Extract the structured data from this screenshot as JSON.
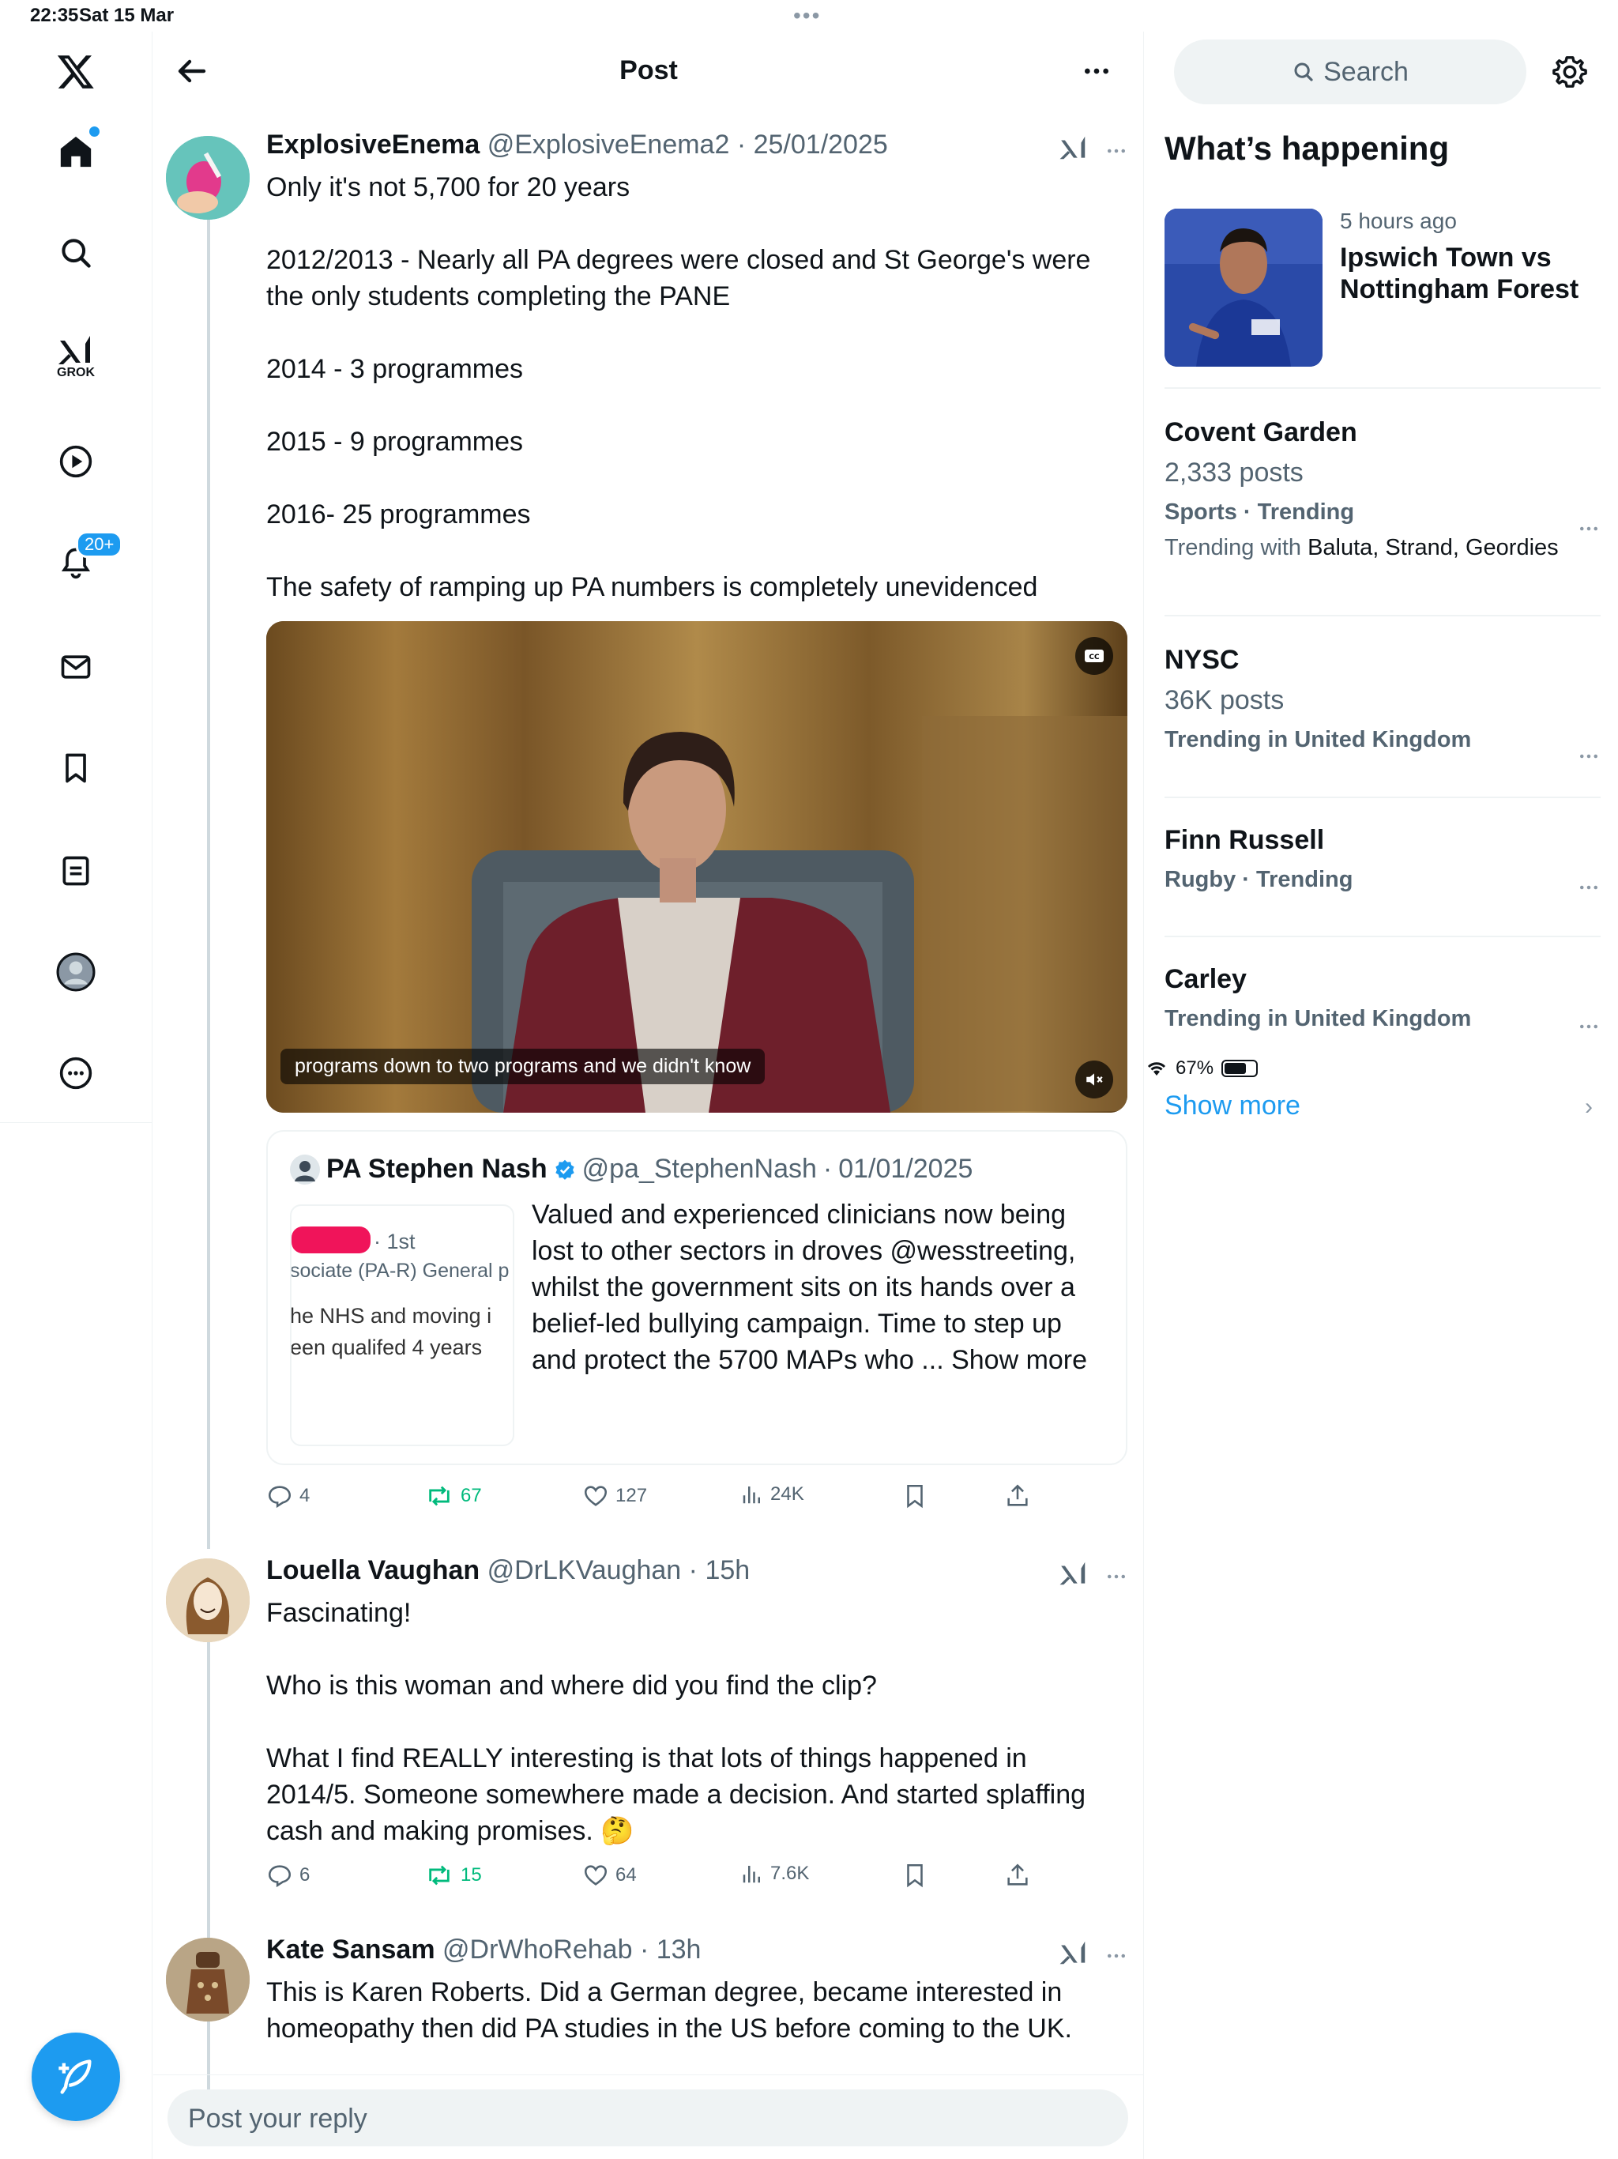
{
  "status_bar": {
    "time": "22:35",
    "date": "Sat 15 Mar",
    "battery": "67%",
    "battery_level": 0.67
  },
  "nav": {
    "grok_label": "GROK",
    "notifications_badge": "20+"
  },
  "header": {
    "title": "Post"
  },
  "main_post": {
    "name": "ExplosiveEnema",
    "handle": "@ExplosiveEnema2",
    "date": "25/01/2025",
    "lines": [
      "Only it's not 5,700 for 20 years",
      "2012/2013 - Nearly all PA degrees were closed and St George's were the only students completing the PANE",
      "2014 - 3 programmes",
      "2015 - 9 programmes",
      "2016- 25 programmes",
      "The safety of ramping up PA numbers is completely unevidenced"
    ],
    "video_caption": "programs down to two programs and we didn't know",
    "quote": {
      "name": "PA Stephen Nash",
      "handle": "@pa_StephenNash",
      "date": "01/01/2025",
      "image_text": [
        "· 1st",
        "sociate (PA-R) General p",
        "he NHS and moving i",
        "een qualifed 4 years"
      ],
      "text": "Valued and experienced clinicians now being lost to other sectors in droves @wesstreeting, whilst the government sits on its hands over a belief-led bullying campaign. Time to step up and protect the 5700 MAPs who ... Show more"
    },
    "stats": {
      "replies": "4",
      "reposts": "67",
      "likes": "127",
      "views": "24K"
    }
  },
  "replies": [
    {
      "name": "Louella Vaughan",
      "handle": "@DrLKVaughan",
      "time": "15h",
      "lines": [
        "Fascinating!",
        "Who is this woman and where did you find the clip?",
        "What I find REALLY interesting is that lots of things happened in 2014/5. Someone somewhere made a decision. And started splaffing cash and making promises. 🤔"
      ],
      "stats": {
        "replies": "6",
        "reposts": "15",
        "likes": "64",
        "views": "7.6K"
      }
    },
    {
      "name": "Kate Sansam",
      "handle": "@DrWhoRehab",
      "time": "13h",
      "lines": [
        "This is Karen Roberts. Did a German degree, became interested in homeopathy then did PA studies in the US before coming to the UK."
      ]
    }
  ],
  "reply_placeholder": "Post your reply",
  "sidebar": {
    "search_placeholder": "Search",
    "title": "What’s happening",
    "news": {
      "meta": "5 hours ago",
      "title": "Ipswich Town vs Nottingham Forest"
    },
    "trends": [
      {
        "name": "Covent Garden",
        "count": "2,333 posts",
        "context": "Sports · Trending",
        "with_label": "Trending with",
        "with": "Baluta, Strand, Geordies"
      },
      {
        "name": "NYSC",
        "count": "36K posts",
        "context": "Trending in United Kingdom"
      },
      {
        "name": "Finn Russell",
        "context": "Rugby · Trending"
      },
      {
        "name": "Carley",
        "context": "Trending in United Kingdom"
      }
    ],
    "show_more": "Show more"
  },
  "colors": {
    "accent": "#1d9bf0",
    "repost_green": "#00ba7c",
    "secondary_text": "#536471"
  }
}
